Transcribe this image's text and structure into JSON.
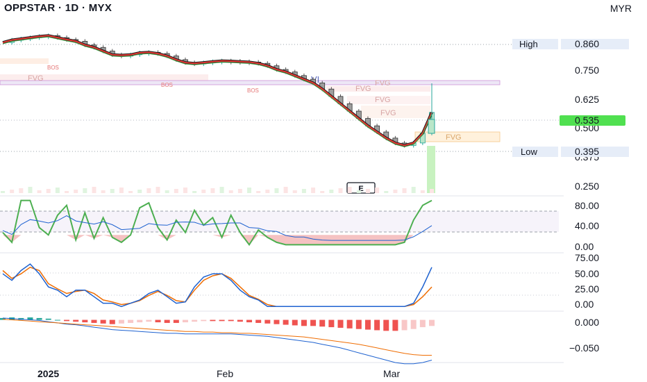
{
  "header": {
    "title": "OPPSTAR · 1D · MYX",
    "currency": "MYR"
  },
  "badges": {
    "high_label": "High",
    "high_value": "0.860",
    "low_label": "Low",
    "low_value": "0.395",
    "last_value": "0.535"
  },
  "annotations": {
    "bos_1": "BOS",
    "bos_2": "BOS",
    "bos_3": "BOS",
    "fvg_1": "FVG",
    "fvg_2": "FVG",
    "fvg_3": "FVG",
    "fvg_4": "FVG",
    "fvg_5": "FVG",
    "fvg_6": "FVG",
    "vi": "VI",
    "earnings": "E"
  },
  "colors": {
    "up": "#26a69a",
    "down": "#131722",
    "ma_fast": "#e53935",
    "ma_slow": "#43a047",
    "osc_line": "#4caf50",
    "signal_blue": "#1e62d0",
    "signal_orange": "#ef6c00",
    "macd_neg": "#ef5350",
    "last_badge": "#50e050",
    "badge_bg": "#e6edf8"
  },
  "chart_data": [
    {
      "type": "line",
      "pane": "price",
      "title": "",
      "y_ticks": [
        "0.750",
        "0.625",
        "0.500",
        "0.375",
        "0.250"
      ],
      "ylim": [
        0.2,
        0.88
      ],
      "x_labels": [
        "2025",
        "Feb",
        "Mar"
      ],
      "series": [
        {
          "values": [
            0.82,
            0.83,
            0.835,
            0.84,
            0.845,
            0.848,
            0.84,
            0.832,
            0.825,
            0.81,
            0.8,
            0.785,
            0.77,
            0.768,
            0.77,
            0.778,
            0.78,
            0.775,
            0.765,
            0.75,
            0.738,
            0.735,
            0.738,
            0.742,
            0.745,
            0.744,
            0.742,
            0.74,
            0.735,
            0.725,
            0.71,
            0.7,
            0.685,
            0.67,
            0.655,
            0.63,
            0.6,
            0.57,
            0.54,
            0.51,
            0.48,
            0.455,
            0.43,
            0.41,
            0.4,
            0.41,
            0.45,
            0.535
          ]
        }
      ]
    },
    {
      "type": "line",
      "pane": "oscillator",
      "y_ticks": [
        "80.00",
        "40.00",
        "0.00"
      ],
      "ylim": [
        0,
        100
      ],
      "series": [
        {
          "values": [
            30,
            10,
            95,
            95,
            40,
            25,
            65,
            85,
            15,
            70,
            18,
            60,
            20,
            10,
            25,
            80,
            90,
            40,
            15,
            55,
            30,
            75,
            45,
            60,
            20,
            65,
            30,
            5,
            35,
            20,
            10,
            5,
            5,
            5,
            5,
            5,
            5,
            5,
            5,
            5,
            5,
            5,
            5,
            5,
            10,
            55,
            85,
            95
          ]
        }
      ]
    },
    {
      "type": "line",
      "pane": "stochastic",
      "y_ticks": [
        "75.00",
        "50.00",
        "25.00",
        "0.00"
      ],
      "ylim": [
        0,
        85
      ],
      "series": [
        {
          "values": [
            55,
            45,
            60,
            70,
            55,
            35,
            30,
            20,
            30,
            30,
            20,
            10,
            10,
            5,
            10,
            15,
            25,
            30,
            20,
            10,
            12,
            35,
            50,
            55,
            55,
            45,
            30,
            20,
            15,
            5,
            5,
            5,
            5,
            5,
            5,
            5,
            5,
            5,
            5,
            5,
            5,
            5,
            5,
            5,
            5,
            10,
            35,
            65
          ]
        },
        {
          "values": [
            60,
            48,
            55,
            65,
            60,
            40,
            32,
            25,
            28,
            30,
            25,
            15,
            12,
            8,
            10,
            14,
            22,
            28,
            22,
            14,
            12,
            30,
            45,
            52,
            55,
            48,
            35,
            22,
            16,
            8,
            5,
            5,
            5,
            5,
            5,
            5,
            5,
            5,
            5,
            5,
            5,
            5,
            5,
            5,
            5,
            8,
            20,
            35
          ]
        }
      ]
    },
    {
      "type": "bar",
      "pane": "macd",
      "y_ticks": [
        "0.000",
        "−0.050"
      ],
      "ylim": [
        -0.07,
        0.012
      ],
      "series": [
        {
          "values": [
            0.003,
            0.004,
            0.003,
            0.004,
            0.003,
            0.002,
            0.0,
            -0.002,
            -0.003,
            -0.004,
            -0.005,
            -0.006,
            -0.007,
            -0.006,
            -0.005,
            -0.004,
            -0.003,
            -0.004,
            -0.005,
            -0.005,
            -0.004,
            -0.003,
            -0.002,
            -0.002,
            -0.002,
            -0.002,
            -0.003,
            -0.004,
            -0.005,
            -0.006,
            -0.007,
            -0.008,
            -0.009,
            -0.01,
            -0.01,
            -0.011,
            -0.012,
            -0.013,
            -0.014,
            -0.015,
            -0.016,
            -0.017,
            -0.018,
            -0.018,
            -0.017,
            -0.015,
            -0.012,
            -0.01
          ]
        },
        {
          "values": [
            0.003,
            0.002,
            0.001,
            0.0,
            -0.001,
            -0.003,
            -0.005,
            -0.007,
            -0.008,
            -0.01,
            -0.012,
            -0.014,
            -0.016,
            -0.017,
            -0.018,
            -0.019,
            -0.02,
            -0.021,
            -0.022,
            -0.022,
            -0.023,
            -0.023,
            -0.023,
            -0.023,
            -0.023,
            -0.023,
            -0.024,
            -0.025,
            -0.026,
            -0.027,
            -0.029,
            -0.031,
            -0.033,
            -0.035,
            -0.037,
            -0.04,
            -0.043,
            -0.046,
            -0.05,
            -0.054,
            -0.058,
            -0.062,
            -0.066,
            -0.07,
            -0.072,
            -0.072,
            -0.07,
            -0.066
          ]
        },
        {
          "values": [
            0.001,
            0.0,
            -0.001,
            -0.002,
            -0.003,
            -0.004,
            -0.005,
            -0.006,
            -0.007,
            -0.008,
            -0.009,
            -0.01,
            -0.011,
            -0.012,
            -0.013,
            -0.014,
            -0.015,
            -0.016,
            -0.017,
            -0.018,
            -0.019,
            -0.019,
            -0.02,
            -0.02,
            -0.021,
            -0.021,
            -0.022,
            -0.022,
            -0.023,
            -0.024,
            -0.025,
            -0.026,
            -0.027,
            -0.028,
            -0.03,
            -0.032,
            -0.034,
            -0.036,
            -0.038,
            -0.04,
            -0.043,
            -0.046,
            -0.049,
            -0.052,
            -0.055,
            -0.057,
            -0.058,
            -0.058
          ]
        }
      ]
    }
  ]
}
